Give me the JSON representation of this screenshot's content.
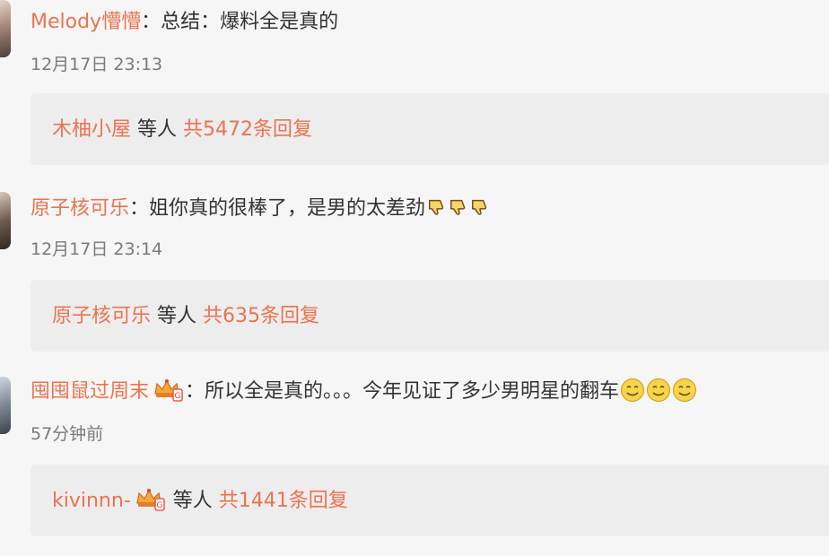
{
  "comments": [
    {
      "username": "Melody懵懵",
      "separator": "：",
      "text": "总结：爆料全是真的",
      "time": "12月17日 23:13",
      "reply": {
        "from": "木柚小屋",
        "middle": " 等人 ",
        "count": "共5472条回复"
      }
    },
    {
      "username": "原子核可乐",
      "separator": "：",
      "text": "姐你真的很棒了，是男的太差劲",
      "emojis": [
        "thumbs-down-icon",
        "thumbs-down-icon",
        "thumbs-down-icon"
      ],
      "time": "12月17日 23:14",
      "reply": {
        "from": "原子核可乐",
        "middle": " 等人 ",
        "count": "共635条回复"
      }
    },
    {
      "username": "囤囤鼠过周末",
      "separator": "：",
      "text": "所以全是真的。。。今年见证了多少男明星的翻车",
      "emojis": [
        "smile-icon",
        "smile-icon",
        "smile-icon"
      ],
      "time": "57分钟前",
      "reply": {
        "from": "kivinnn-",
        "middle": " 等人 ",
        "count": "共1441条回复"
      }
    }
  ],
  "colors": {
    "username": "#eb7350",
    "text": "#333333",
    "time": "#7a7a7a",
    "reply_bg": "#ededed"
  }
}
